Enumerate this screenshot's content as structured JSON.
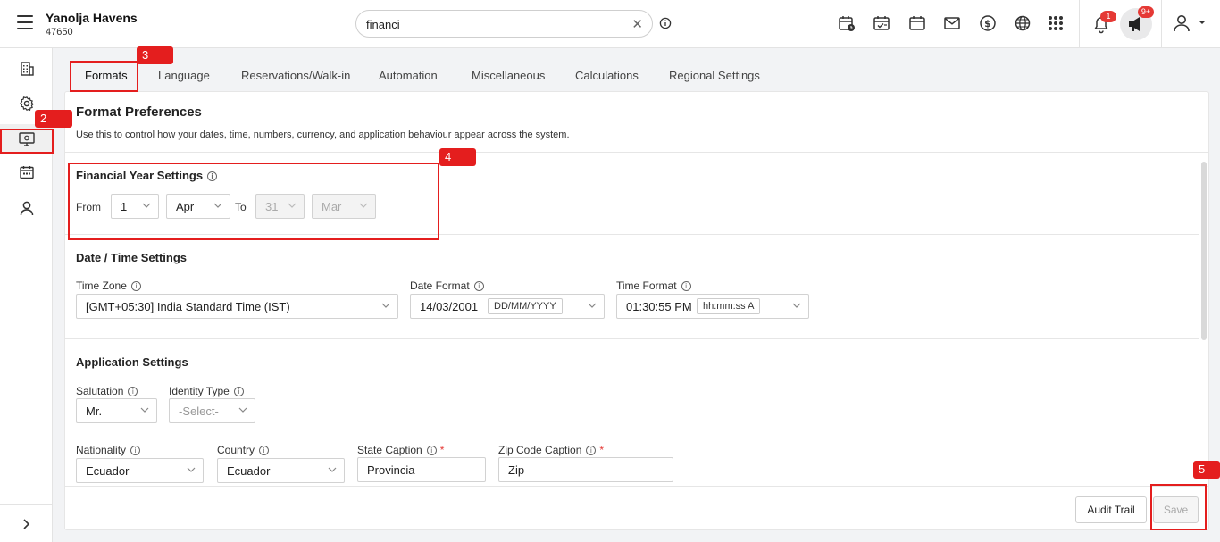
{
  "header": {
    "hotel_name": "Yanolja Havens",
    "hotel_id": "47650",
    "search_value": "financi",
    "notification_count": "1",
    "announcement_count": "9+"
  },
  "tabs": [
    {
      "label": "Formats",
      "active": true
    },
    {
      "label": "Language"
    },
    {
      "label": "Reservations/Walk-in"
    },
    {
      "label": "Automation"
    },
    {
      "label": "Miscellaneous"
    },
    {
      "label": "Calculations"
    },
    {
      "label": "Regional Settings"
    }
  ],
  "page": {
    "title": "Format Preferences",
    "subtitle": "Use this to control how your dates, time, numbers, currency, and application behaviour appear across the system."
  },
  "financial_year": {
    "title": "Financial Year Settings",
    "from_label": "From",
    "from_day": "1",
    "from_month": "Apr",
    "to_label": "To",
    "to_day": "31",
    "to_month": "Mar"
  },
  "date_time": {
    "title": "Date / Time Settings",
    "timezone_label": "Time Zone",
    "timezone_value": "[GMT+05:30] India Standard Time (IST)",
    "date_format_label": "Date Format",
    "date_value": "14/03/2001",
    "date_pattern": "DD/MM/YYYY",
    "time_format_label": "Time Format",
    "time_value": "01:30:55 PM",
    "time_pattern": "hh:mm:ss A"
  },
  "application": {
    "title": "Application Settings",
    "salutation_label": "Salutation",
    "salutation_value": "Mr.",
    "identity_label": "Identity Type",
    "identity_value": "-Select-",
    "nationality_label": "Nationality",
    "nationality_value": "Ecuador",
    "country_label": "Country",
    "country_value": "Ecuador",
    "state_caption_label": "State Caption",
    "state_caption_value": "Provincia",
    "zip_caption_label": "Zip Code Caption",
    "zip_caption_value": "Zip",
    "required_mark": "*"
  },
  "footer": {
    "audit_trail_label": "Audit Trail",
    "save_label": "Save"
  },
  "annotations": [
    "2",
    "3",
    "4",
    "5"
  ],
  "colors": {
    "annotation_red": "#e41e1e",
    "badge_red": "#e53935"
  }
}
